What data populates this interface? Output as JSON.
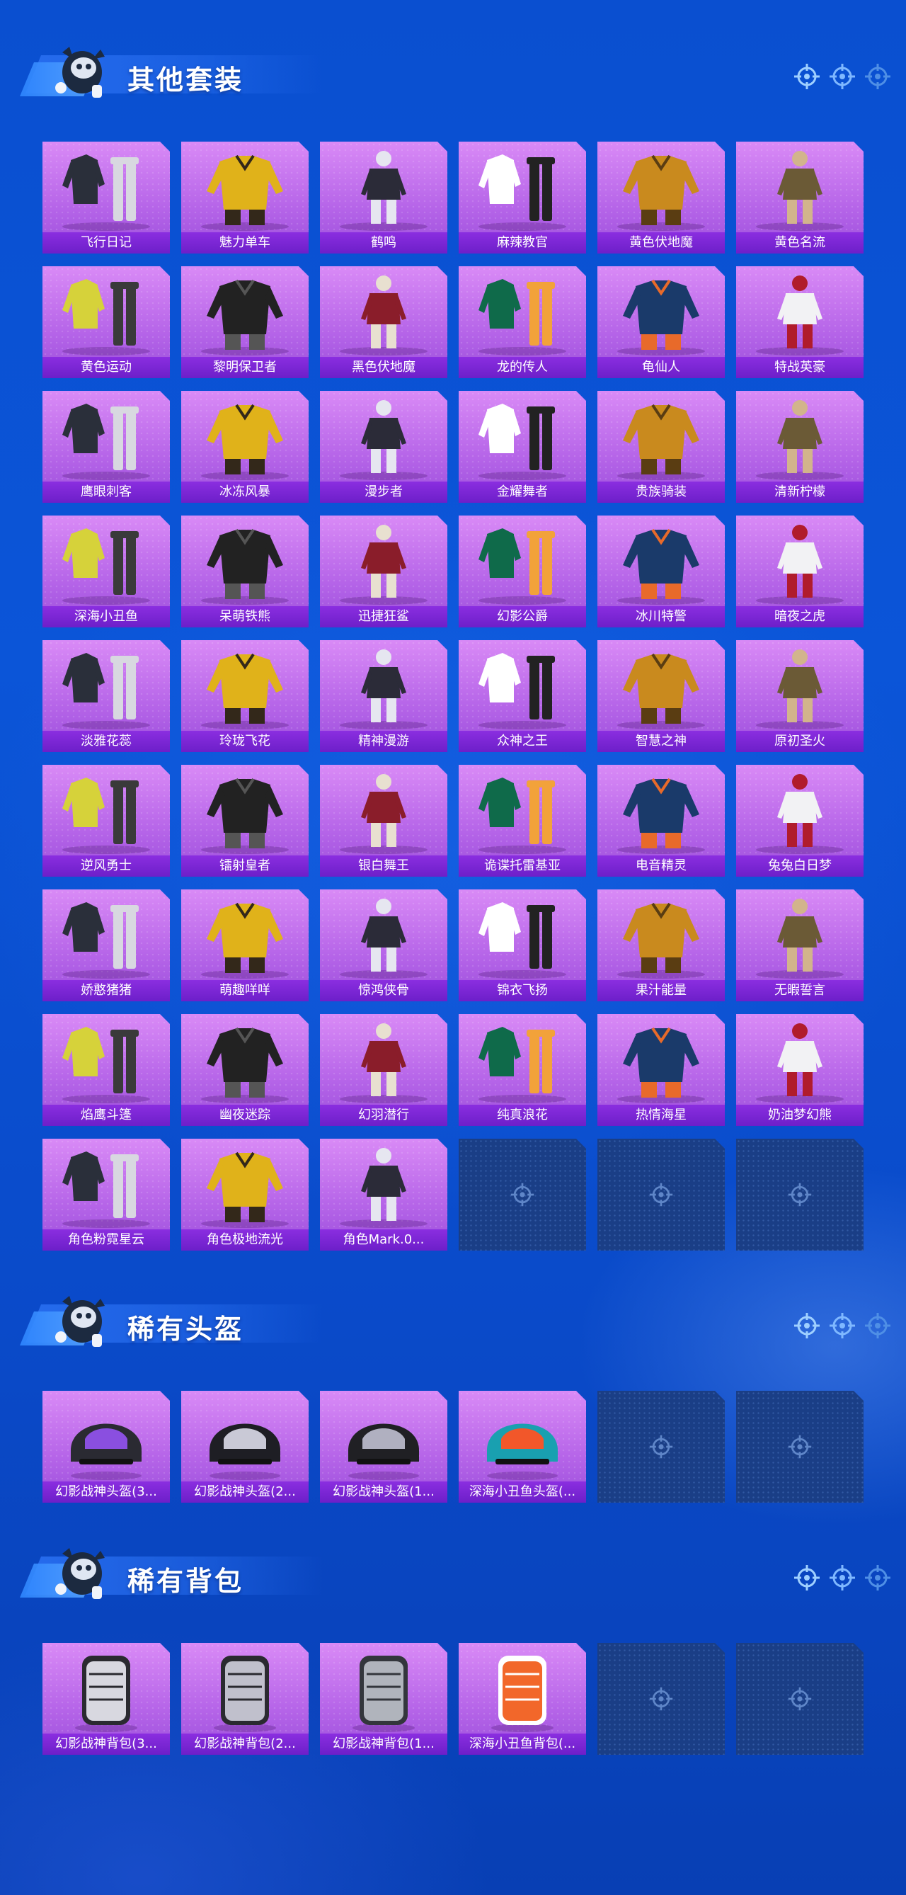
{
  "colors": {
    "card_top": "#d98af6",
    "card_label": "#7a24d4",
    "empty_slot": "#1a3e86",
    "background": "#0b55d8"
  },
  "sections": [
    {
      "title": "其他套装",
      "items": [
        "飞行日记",
        "魅力单车",
        "鹤鸣",
        "麻辣教官",
        "黄色伏地魔",
        "黄色名流",
        "黄色运动",
        "黎明保卫者",
        "黑色伏地魔",
        "龙的传人",
        "龟仙人",
        "特战英豪",
        "鹰眼刺客",
        "冰冻风暴",
        "漫步者",
        "金耀舞者",
        "贵族骑装",
        "清新柠檬",
        "深海小丑鱼",
        "呆萌铁熊",
        "迅捷狂鲨",
        "幻影公爵",
        "冰川特警",
        "暗夜之虎",
        "淡雅花蕊",
        "玲珑飞花",
        "精神漫游",
        "众神之王",
        "智慧之神",
        "原初圣火",
        "逆风勇士",
        "镭射皇者",
        "银白舞王",
        "诡谍托雷基亚",
        "电音精灵",
        "兔兔白日梦",
        "娇憨猪猪",
        "萌趣咩咩",
        "惊鸿侠骨",
        "锦衣飞扬",
        "果汁能量",
        "无暇誓言",
        "焰鹰斗篷",
        "幽夜迷踪",
        "幻羽潜行",
        "纯真浪花",
        "热情海星",
        "奶油梦幻熊",
        "角色粉霓星云",
        "角色极地流光",
        "角色Mark.0..."
      ],
      "empty_slots": 3
    },
    {
      "title": "稀有头盔",
      "items": [
        "幻影战神头盔(3...",
        "幻影战神头盔(2...",
        "幻影战神头盔(1...",
        "深海小丑鱼头盔(..."
      ],
      "empty_slots": 2
    },
    {
      "title": "稀有背包",
      "items": [
        "幻影战神背包(3...",
        "幻影战神背包(2...",
        "幻影战神背包(1...",
        "深海小丑鱼背包(..."
      ],
      "empty_slots": 2
    }
  ]
}
